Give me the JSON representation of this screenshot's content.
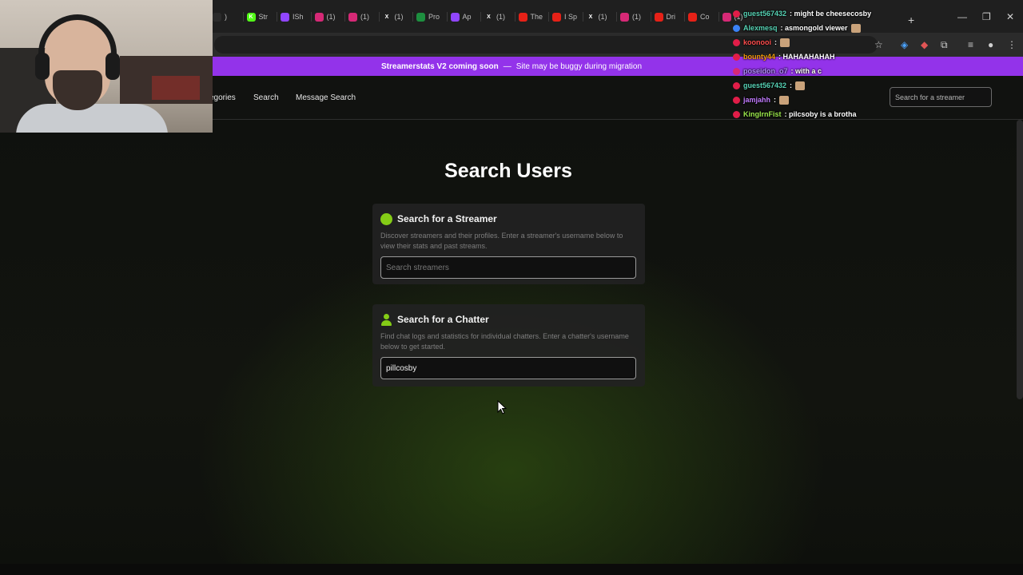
{
  "browser": {
    "tabs": [
      {
        "label": ")",
        "icon": "tab-icon",
        "color": "#2b2b2b",
        "glyph": ""
      },
      {
        "label": "Str",
        "icon": "kick-icon",
        "color": "#53fc18",
        "glyph": "K"
      },
      {
        "label": "ISh",
        "icon": "twitch-icon",
        "color": "#9146ff",
        "glyph": ""
      },
      {
        "label": "(1)",
        "icon": "instagram-icon",
        "color": "#d62976",
        "glyph": ""
      },
      {
        "label": "(1)",
        "icon": "instagram-icon",
        "color": "#d62976",
        "glyph": ""
      },
      {
        "label": "(1)",
        "icon": "x-icon",
        "color": "#1f1f1f",
        "glyph": "X"
      },
      {
        "label": "Pro",
        "icon": "pin-icon",
        "color": "#1d8f3f",
        "glyph": ""
      },
      {
        "label": "Ap",
        "icon": "twitch-icon",
        "color": "#9146ff",
        "glyph": ""
      },
      {
        "label": "(1)",
        "icon": "x-icon",
        "color": "#1f1f1f",
        "glyph": "X"
      },
      {
        "label": "The",
        "icon": "youtube-icon",
        "color": "#e62117",
        "glyph": ""
      },
      {
        "label": "I Sp",
        "icon": "youtube-icon",
        "color": "#e62117",
        "glyph": ""
      },
      {
        "label": "(1)",
        "icon": "x-icon",
        "color": "#1f1f1f",
        "glyph": "X"
      },
      {
        "label": "(1)",
        "icon": "instagram-icon",
        "color": "#d62976",
        "glyph": ""
      },
      {
        "label": "Dri",
        "icon": "youtube-icon",
        "color": "#e62117",
        "glyph": ""
      },
      {
        "label": "Co",
        "icon": "youtube-icon",
        "color": "#e62117",
        "glyph": ""
      },
      {
        "label": "(1)",
        "icon": "instagram-icon",
        "color": "#d62976",
        "glyph": ""
      }
    ],
    "new_tab": "+",
    "window_controls": {
      "minimize": "—",
      "restore": "❐",
      "close": "✕"
    }
  },
  "site": {
    "banner": {
      "bold": "Streamerstats V2 coming soon",
      "dash": "—",
      "text": "Site may be buggy during migration"
    },
    "nav": {
      "links": [
        "egories",
        "Search",
        "Message Search"
      ],
      "search_placeholder": "Search for a streamer"
    },
    "title": "Search Users",
    "accent_color": "#84cc16",
    "streamer_card": {
      "icon": "circle-icon",
      "title": "Search for a Streamer",
      "description": "Discover streamers and their profiles. Enter a streamer's username below to view their stats and past streams.",
      "placeholder": "Search streamers",
      "value": ""
    },
    "chatter_card": {
      "icon": "user-icon",
      "title": "Search for a Chatter",
      "description": "Find chat logs and statistics for individual chatters. Enter a chatter's username below to get started.",
      "placeholder": "",
      "value": "pillcosby"
    }
  },
  "chat": [
    {
      "user": "guest567432",
      "user_color": "#57d3b5",
      "badge_color": "#e11d48",
      "message": ": might be cheesecosby",
      "emote": false
    },
    {
      "user": "Alexmesq",
      "user_color": "#57d3b5",
      "badge_color": "#3b82f6",
      "message": ": asmongold viewer",
      "emote": true
    },
    {
      "user": "koonooi",
      "user_color": "#ff4d4d",
      "badge_color": "#e11d48",
      "message": ":",
      "emote": true
    },
    {
      "user": "bounty44",
      "user_color": "#f59e0b",
      "badge_color": "#e11d48",
      "message": ": HAHAAHAHAH",
      "emote": false
    },
    {
      "user": "poseidon_o7",
      "user_color": "#b18cff",
      "badge_color": "#d62976",
      "message": ": with a c",
      "emote": false
    },
    {
      "user": "guest567432",
      "user_color": "#57d3b5",
      "badge_color": "#e11d48",
      "message": ":",
      "emote": true
    },
    {
      "user": "jamjahh",
      "user_color": "#c27cff",
      "badge_color": "#e11d48",
      "message": ":",
      "emote": true
    },
    {
      "user": "KingIrnFist",
      "user_color": "#9be84b",
      "badge_color": "#e11d48",
      "message": ": pilcsoby is a brotha",
      "emote": false
    }
  ]
}
